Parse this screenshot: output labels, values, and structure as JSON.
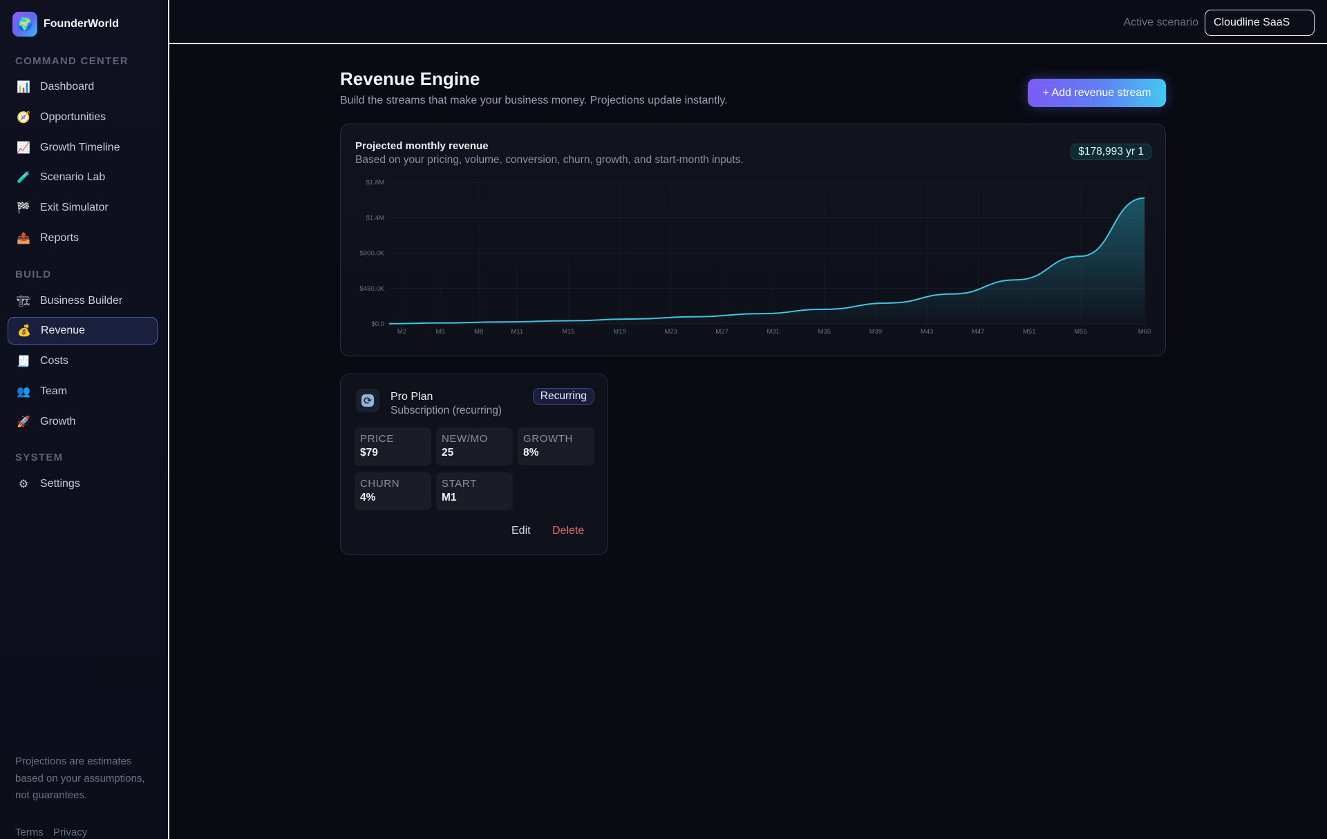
{
  "brand": {
    "name": "FounderWorld",
    "logo_icon": "globe-icon"
  },
  "sidebar": {
    "sections": [
      {
        "title": "COMMAND CENTER"
      },
      {
        "title": "BUILD"
      },
      {
        "title": "SYSTEM"
      }
    ],
    "items": [
      {
        "label": "Dashboard",
        "icon": "📊"
      },
      {
        "label": "Opportunities",
        "icon": "🧭"
      },
      {
        "label": "Growth Timeline",
        "icon": "📈"
      },
      {
        "label": "Scenario Lab",
        "icon": "🧪"
      },
      {
        "label": "Exit Simulator",
        "icon": "🏁"
      },
      {
        "label": "Reports",
        "icon": "📤"
      },
      {
        "label": "Business Builder",
        "icon": "🏗"
      },
      {
        "label": "Revenue",
        "icon": "💰"
      },
      {
        "label": "Costs",
        "icon": "🧾"
      },
      {
        "label": "Team",
        "icon": "👥"
      },
      {
        "label": "Growth",
        "icon": "🚀"
      },
      {
        "label": "Settings",
        "icon": "⚙"
      }
    ],
    "active_item": "Revenue",
    "footer_note": "Projections are estimates based on your assumptions, not guarantees.",
    "footer_links": [
      "Terms",
      "Privacy"
    ]
  },
  "topbar": {
    "scenario_label": "Active scenario",
    "scenario_value": "Cloudline SaaS"
  },
  "page": {
    "title": "Revenue Engine",
    "subtitle": "Build the streams that make your business money. Projections update instantly.",
    "add_button": "+ Add revenue stream"
  },
  "chart_card": {
    "title": "Projected monthly revenue",
    "subtitle": "Based on your pricing, volume, conversion, churn, growth, and start-month inputs.",
    "badge": "$178,993 yr 1"
  },
  "chart_data": {
    "type": "area",
    "x_ticks": [
      "M2",
      "M5",
      "M8",
      "M11",
      "M15",
      "M19",
      "M23",
      "M27",
      "M31",
      "M35",
      "M39",
      "M43",
      "M47",
      "M51",
      "M55",
      "M60"
    ],
    "y_ticks": [
      "$0.0",
      "$450.0K",
      "$900.0K",
      "$1.4M",
      "$1.8M"
    ],
    "ylim": [
      0,
      1800000
    ],
    "series": [
      {
        "x": [
          1,
          5,
          10,
          15,
          20,
          25,
          30,
          35,
          40,
          45,
          50,
          55,
          60
        ],
        "y": [
          2000,
          12000,
          24000,
          40000,
          62000,
          91000,
          130000,
          185000,
          265000,
          380000,
          560000,
          860000,
          1600000
        ]
      }
    ],
    "line_color": "#3fc6e0"
  },
  "stream": {
    "name": "Pro Plan",
    "type": "Subscription (recurring)",
    "badge": "Recurring",
    "icon": "refresh-icon",
    "metrics": [
      {
        "label": "PRICE",
        "value": "$79"
      },
      {
        "label": "NEW/MO",
        "value": "25"
      },
      {
        "label": "GROWTH",
        "value": "8%"
      },
      {
        "label": "CHURN",
        "value": "4%"
      },
      {
        "label": "START",
        "value": "M1"
      }
    ],
    "edit_label": "Edit",
    "delete_label": "Delete"
  }
}
